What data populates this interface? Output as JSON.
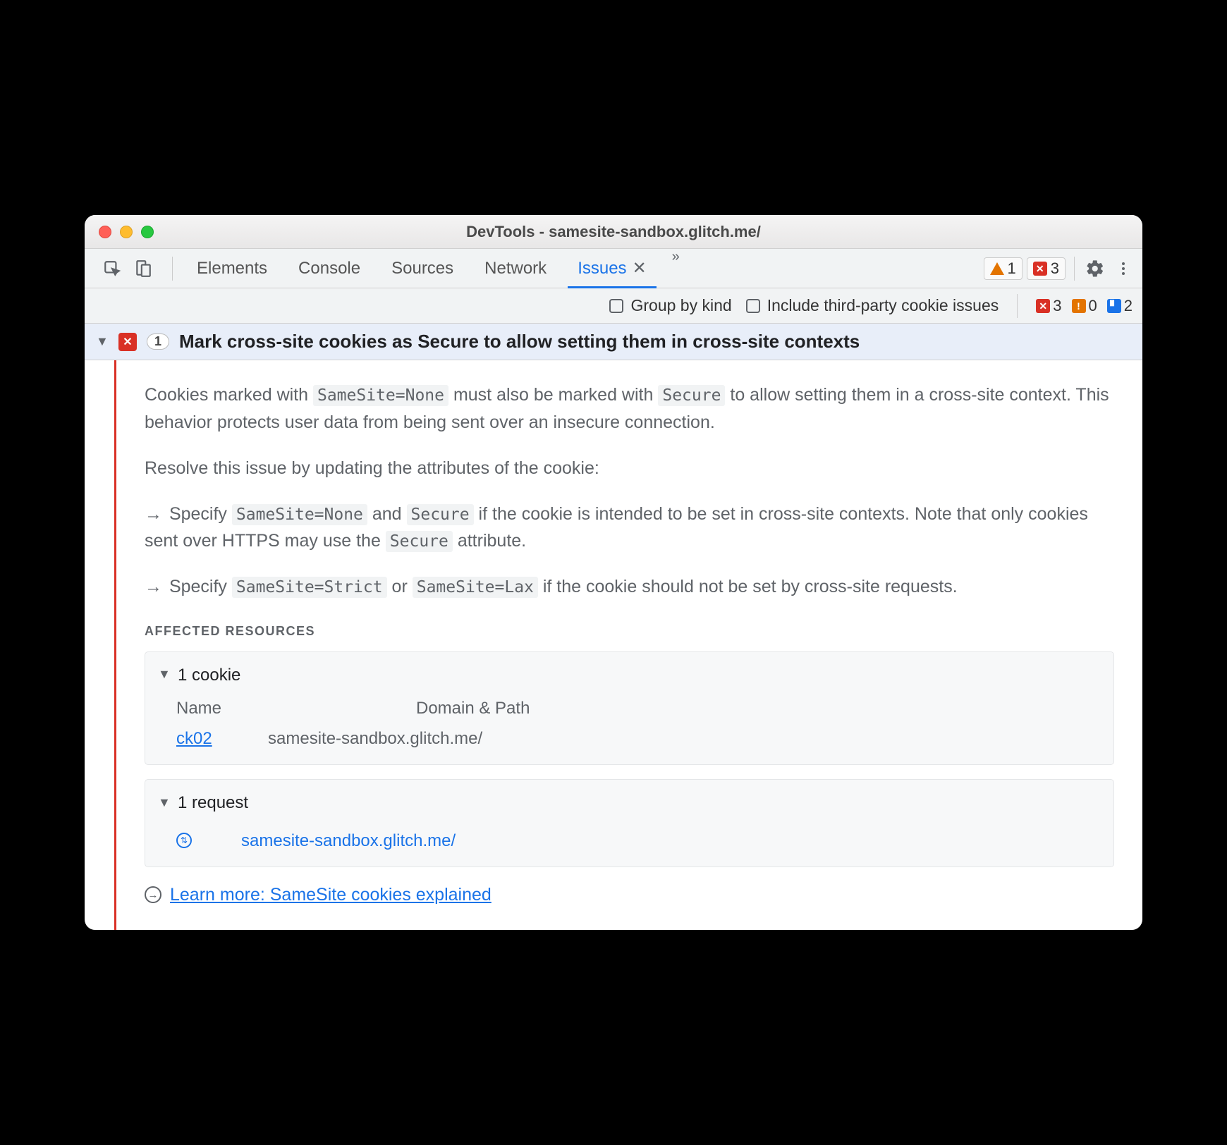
{
  "window": {
    "title": "DevTools - samesite-sandbox.glitch.me/"
  },
  "tabs": {
    "items": [
      "Elements",
      "Console",
      "Sources",
      "Network"
    ],
    "active": "Issues",
    "top_badges": {
      "warn": "1",
      "error": "3"
    }
  },
  "filter": {
    "group_by_kind": "Group by kind",
    "include_third_party": "Include third-party cookie issues",
    "badges": {
      "error": "3",
      "warn": "0",
      "info": "2"
    }
  },
  "issue": {
    "count": "1",
    "title": "Mark cross-site cookies as Secure to allow setting them in cross-site contexts",
    "p1a": "Cookies marked with ",
    "p1_code1": "SameSite=None",
    "p1b": " must also be marked with ",
    "p1_code2": "Secure",
    "p1c": " to allow setting them in a cross-site context. This behavior protects user data from being sent over an insecure connection.",
    "p2": "Resolve this issue by updating the attributes of the cookie:",
    "b1a": "Specify ",
    "b1_code1": "SameSite=None",
    "b1b": " and ",
    "b1_code2": "Secure",
    "b1c": " if the cookie is intended to be set in cross-site contexts. Note that only cookies sent over HTTPS may use the ",
    "b1_code3": "Secure",
    "b1d": " attribute.",
    "b2a": "Specify ",
    "b2_code1": "SameSite=Strict",
    "b2b": " or ",
    "b2_code2": "SameSite=Lax",
    "b2c": " if the cookie should not be set by cross-site requests.",
    "affected_title": "AFFECTED RESOURCES",
    "cookies_hd": "1 cookie",
    "cookies_col1": "Name",
    "cookies_col2": "Domain & Path",
    "cookie_name": "ck02",
    "cookie_domain": "samesite-sandbox.glitch.me/",
    "requests_hd": "1 request",
    "request_url": "samesite-sandbox.glitch.me/",
    "learn_more": "Learn more: SameSite cookies explained"
  }
}
